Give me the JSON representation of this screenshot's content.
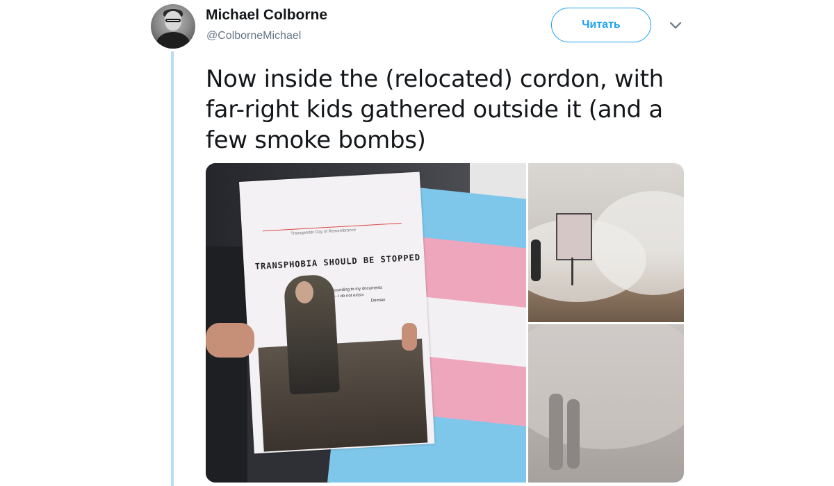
{
  "author": {
    "display_name": "Michael Colborne",
    "handle": "@ColborneMichael"
  },
  "actions": {
    "follow_label": "Читать"
  },
  "tweet": {
    "text_lines": [
      "Now inside the (relocated) cordon, with",
      "far-right kids gathered outside it (and a",
      "few smoke bombs)"
    ]
  },
  "media": {
    "poster": {
      "small_caption": "Transgender Day of Remembrance",
      "headline": "TRANSPHOBIA SHOULD BE STOPPED",
      "quote_line1": "«According to my documents",
      "quote_line2": "– I do not exist»",
      "quote_author": "Demian"
    }
  },
  "colors": {
    "accent": "#1da1f2",
    "thread_line": "#b8dcf2",
    "trans_blue": "#7fc7ea",
    "trans_pink": "#eea6bd"
  }
}
